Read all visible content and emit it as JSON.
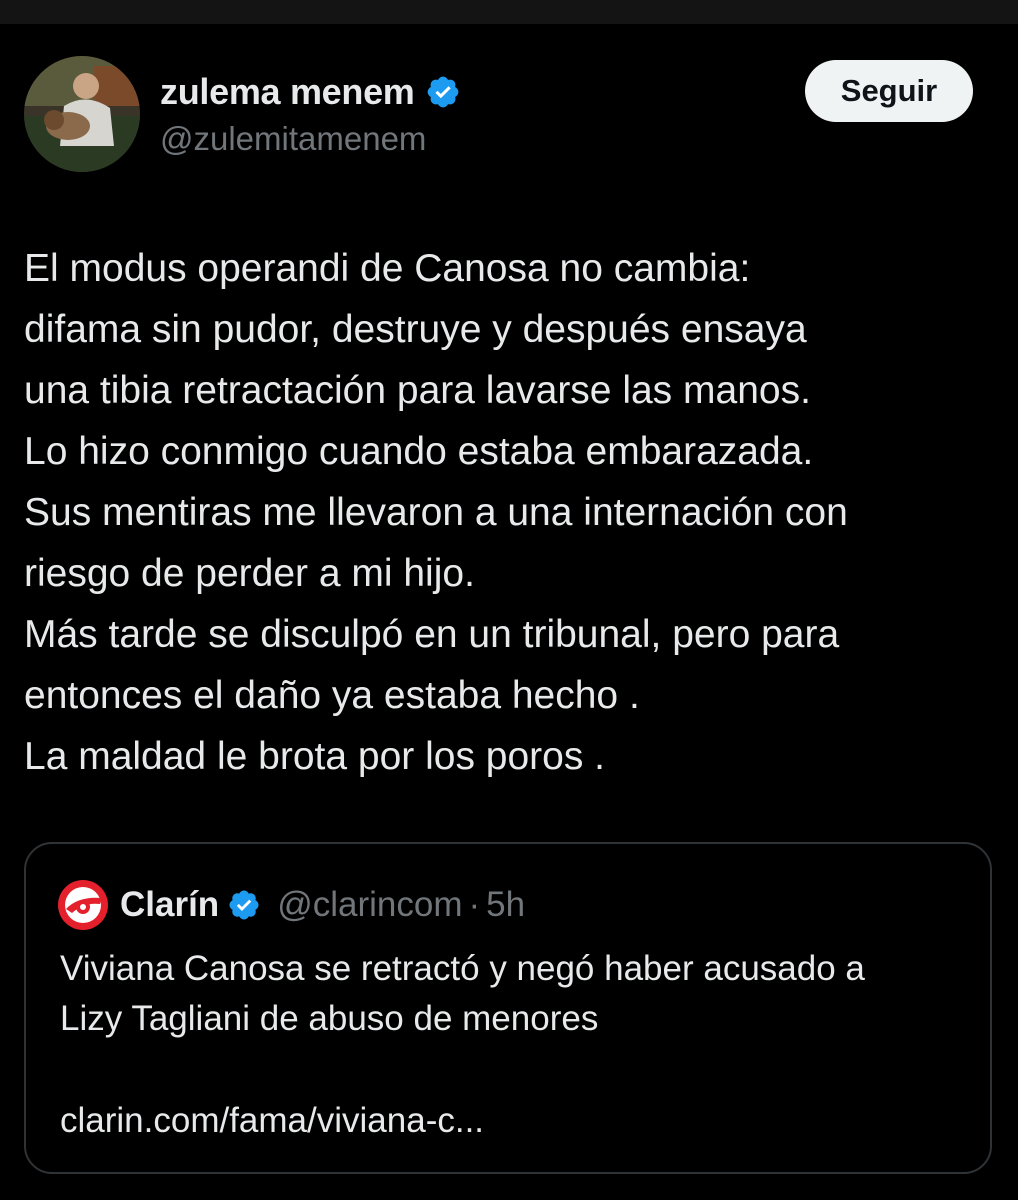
{
  "author": {
    "display_name": "zulema menem",
    "handle": "@zulemitamenem",
    "verified_icon": "verified-badge-icon",
    "avatar_icon": "avatar-photo"
  },
  "actions": {
    "follow_label": "Seguir"
  },
  "tweet": {
    "lines": [
      "El modus operandi de Canosa no cambia:",
      "difama sin pudor, destruye y después ensaya",
      "una tibia retractación para lavarse las manos.",
      "Lo hizo conmigo cuando estaba embarazada.",
      "Sus mentiras me llevaron a una internación con",
      "riesgo de perder a mi hijo.",
      "Más tarde se disculpó en un tribunal, pero para",
      "entonces el daño ya estaba hecho .",
      "La maldad le brota por los poros ."
    ]
  },
  "quoted": {
    "display_name": "Clarín",
    "handle": "@clarincom",
    "separator": "·",
    "time": "5h",
    "logo_icon": "clarin-logo-icon",
    "text_lines": [
      "Viviana Canosa se retractó y negó haber acusado a",
      "Lizy Tagliani de abuso de menores"
    ],
    "link": "clarin.com/fama/viviana-c..."
  },
  "colors": {
    "background": "#000000",
    "text_primary": "#e7e9ea",
    "text_secondary": "#71767b",
    "verified_blue": "#1d9bf0",
    "follow_button_bg": "#eff3f4",
    "quote_border": "#2f3336",
    "clarin_red": "#e3202b"
  }
}
